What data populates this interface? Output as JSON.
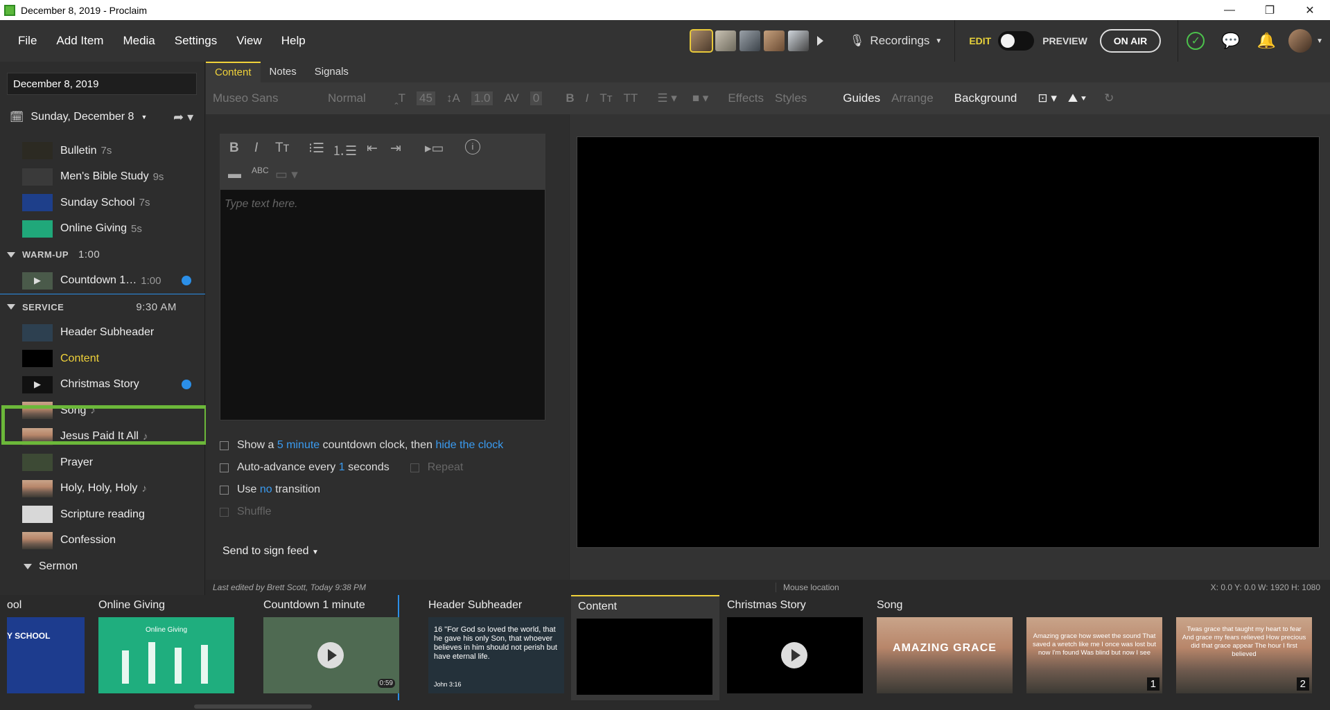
{
  "window": {
    "title": "December 8, 2019 - Proclaim",
    "minimize": "—",
    "maximize": "❐",
    "close": "✕"
  },
  "menu": [
    "File",
    "Add Item",
    "Media",
    "Settings",
    "View",
    "Help"
  ],
  "toolbar_right": {
    "recordings": "Recordings",
    "edit": "EDIT",
    "preview": "PREVIEW",
    "on_air": "ON AIR"
  },
  "sidebar": {
    "date_value": "December 8, 2019",
    "day_selector": "Sunday, December 8",
    "pre_items": [
      {
        "label": "Bulletin",
        "dur": "7s"
      },
      {
        "label": "Men's Bible Study",
        "dur": "9s"
      },
      {
        "label": "Sunday School",
        "dur": "7s"
      },
      {
        "label": "Online Giving",
        "dur": "5s"
      }
    ],
    "warmup": {
      "name": "WARM-UP",
      "time": "1:00",
      "item_label": "Countdown 1…",
      "item_dur": "1:00"
    },
    "service": {
      "name": "SERVICE",
      "time": "9:30 AM"
    },
    "service_items": [
      {
        "label": "Header Subheader"
      },
      {
        "label": "Content"
      },
      {
        "label": "Christmas Story"
      },
      {
        "label": "Song",
        "note": "♪"
      },
      {
        "label": "Jesus Paid It All",
        "note": "♪"
      },
      {
        "label": "Prayer"
      },
      {
        "label": "Holy, Holy, Holy",
        "note": "♪"
      },
      {
        "label": "Scripture reading"
      },
      {
        "label": "Confession"
      }
    ],
    "sermon": "Sermon"
  },
  "tabs": [
    "Content",
    "Notes",
    "Signals"
  ],
  "format": {
    "font": "Museo Sans",
    "style": "Normal",
    "size": "45",
    "line": "1.0",
    "spacing": "0",
    "effects": "Effects",
    "styles": "Styles",
    "guides": "Guides",
    "arrange": "Arrange",
    "background": "Background"
  },
  "editor": {
    "placeholder": "Type text here.",
    "opt1": {
      "a": "Show a",
      "b": "5 minute",
      "c": "countdown clock, then",
      "d": "hide the clock"
    },
    "opt2": {
      "a": "Auto-advance every",
      "b": "1",
      "c": "seconds",
      "d": "Repeat"
    },
    "opt3": {
      "a": "Use",
      "b": "no",
      "c": "transition"
    },
    "opt4": "Shuffle",
    "sign_feed": "Send to sign feed"
  },
  "status": {
    "edited": "Last edited by Brett Scott, Today 9:38 PM",
    "mouse": "Mouse location",
    "coords": "X: 0.0  Y: 0.0    W: 1920  H: 1080"
  },
  "filmstrip": [
    {
      "label": "ool",
      "thumb_text": "Y SCHOOL"
    },
    {
      "label": "Online Giving",
      "thumb_text": "Online Giving"
    },
    {
      "label": "Countdown 1 minute",
      "time": "0:59"
    },
    {
      "label": "Header Subheader",
      "verse": "16 \"For God so loved the world, that he gave his only Son, that whoever believes in him should not perish but have eternal life.",
      "ref": "John 3:16"
    },
    {
      "label": "Content"
    },
    {
      "label": "Christmas Story"
    },
    {
      "label": "Song",
      "thumb_text": "AMAZING GRACE"
    },
    {
      "label": "",
      "lyrics": "Amazing grace how sweet the sound That saved a wretch like me I once was lost but now I'm found Was blind but now I see",
      "badge": "1"
    },
    {
      "label": "",
      "lyrics": "Twas grace that taught my heart to fear And grace my fears relieved How precious did that grace appear The hour I first believed",
      "badge": "2"
    }
  ],
  "colors": {
    "accent": "#f0d23a",
    "link": "#3a9bf0",
    "selection": "#6cb83a",
    "on_air": "#4cc24c"
  }
}
